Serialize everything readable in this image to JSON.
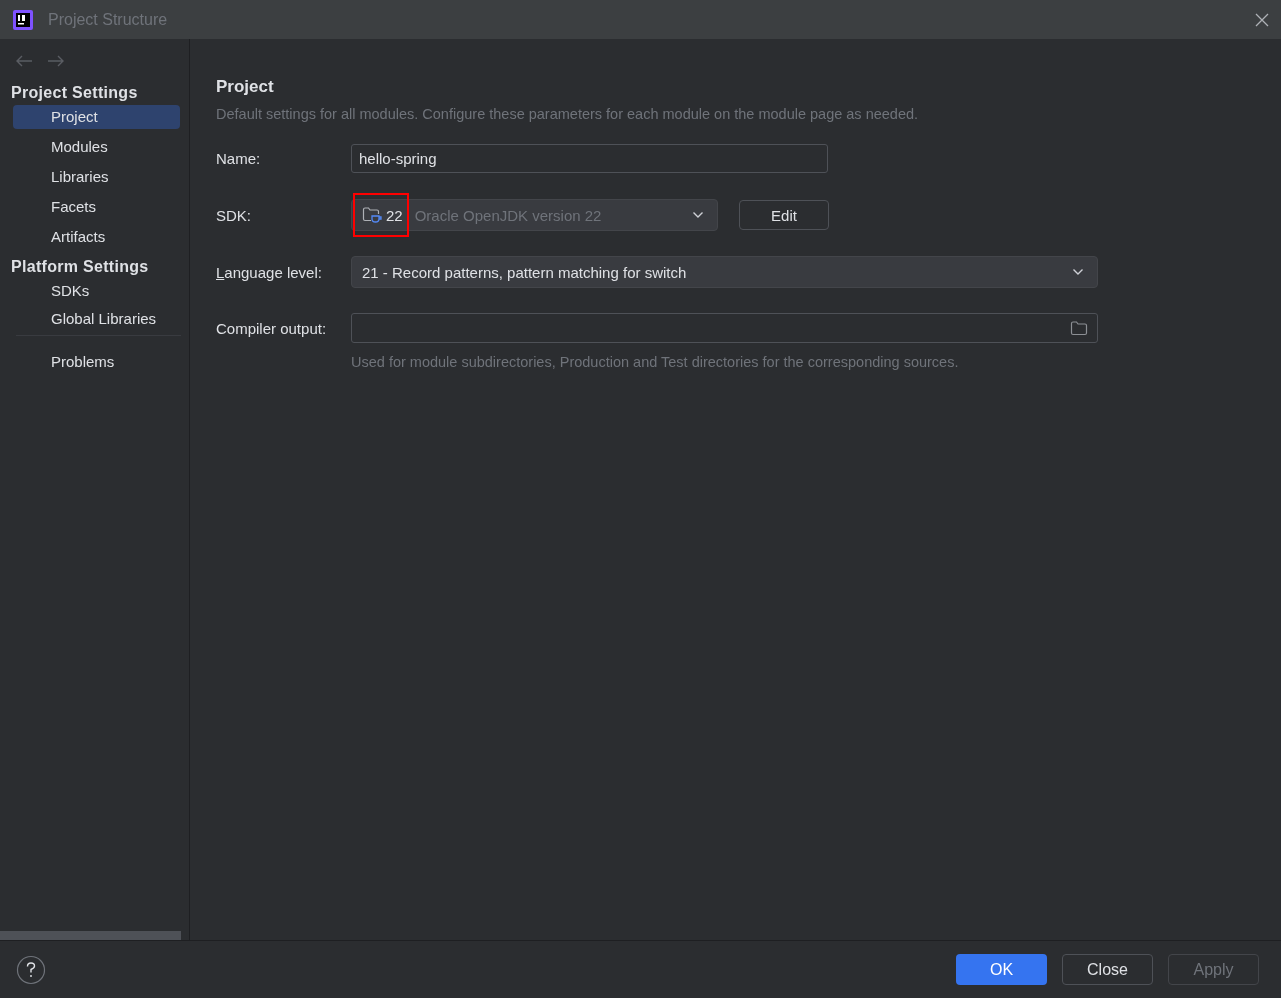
{
  "window": {
    "title": "Project Structure"
  },
  "sidebar": {
    "groups": [
      {
        "header": "Project Settings",
        "items": [
          {
            "label": "Project",
            "selected": true
          },
          {
            "label": "Modules",
            "selected": false
          },
          {
            "label": "Libraries",
            "selected": false
          },
          {
            "label": "Facets",
            "selected": false
          },
          {
            "label": "Artifacts",
            "selected": false
          }
        ]
      },
      {
        "header": "Platform Settings",
        "items": [
          {
            "label": "SDKs",
            "selected": false
          },
          {
            "label": "Global Libraries",
            "selected": false
          }
        ]
      }
    ],
    "footer_items": [
      {
        "label": "Problems",
        "selected": false
      }
    ]
  },
  "page": {
    "title": "Project",
    "description": "Default settings for all modules. Configure these parameters for each module on the module page as needed.",
    "name": {
      "label": "Name:",
      "value": "hello-spring"
    },
    "sdk": {
      "label": "SDK:",
      "version": "22",
      "value": "Oracle OpenJDK version 22",
      "highlighted": true,
      "edit_button": "Edit"
    },
    "language_level": {
      "label": "Language level:",
      "mnemonic_underlined": true,
      "value": "21 - Record patterns, pattern matching for switch"
    },
    "compiler_output": {
      "label": "Compiler output:",
      "hint": "Used for module subdirectories, Production and Test directories for the corresponding sources."
    }
  },
  "buttons": [
    {
      "label": "OK",
      "kind": "primary",
      "disabled": false
    },
    {
      "label": "Close",
      "kind": "secondary",
      "disabled": false
    },
    {
      "label": "Apply",
      "kind": "secondary",
      "disabled": true
    }
  ]
}
